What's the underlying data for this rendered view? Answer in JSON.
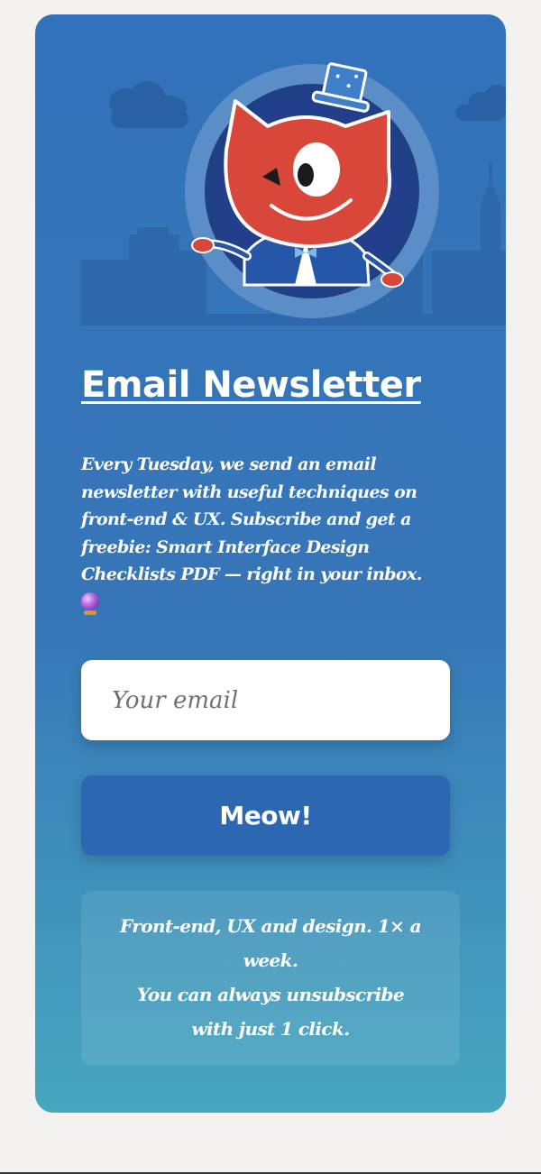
{
  "newsletter": {
    "title": "Email Newsletter",
    "description": "Every Tuesday, we send an email newsletter with useful techniques on front-end & UX. Subscribe and get a freebie: Smart Interface Design Checklists PDF — right in your inbox.",
    "description_emoji_icon": "crystal-ball-icon",
    "email_placeholder": "Your email",
    "submit_label": "Meow!",
    "note_line1": "Front-end, UX and design. 1× a week.",
    "note_line2": "You can always unsubscribe with just 1 click."
  },
  "colors": {
    "card_top": "#3272ba",
    "card_bottom": "#47a6bf",
    "button": "#2c68b2",
    "mascot_red": "#d9473a",
    "page_background": "#f3f2f0"
  }
}
